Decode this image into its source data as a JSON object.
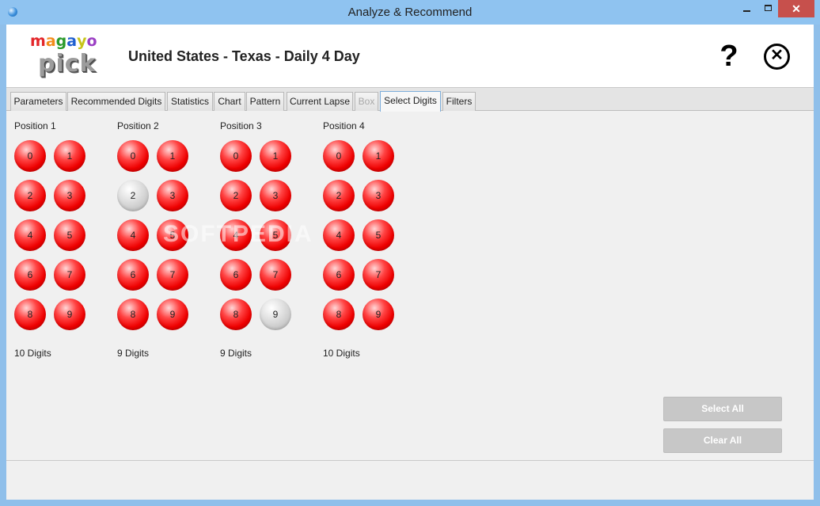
{
  "window": {
    "title": "Analyze & Recommend",
    "minimize_icon": "minimize-icon",
    "maximize_icon": "maximize-icon",
    "close_label": "✕"
  },
  "header": {
    "logo_top": [
      "m",
      "a",
      "g",
      "a",
      "y",
      "o"
    ],
    "logo_top_colors": [
      "#e3262a",
      "#f28c1a",
      "#2a9a2a",
      "#1f5fd0",
      "#c7c41a",
      "#9b3fc4"
    ],
    "logo_bottom": "pick",
    "lottery_title": "United States - Texas - Daily 4 Day",
    "help_label": "?",
    "close_label": "✕"
  },
  "tabs": [
    {
      "label": "Parameters",
      "state": "normal"
    },
    {
      "label": "Recommended Digits",
      "state": "normal"
    },
    {
      "label": "Statistics",
      "state": "normal"
    },
    {
      "label": "Chart",
      "state": "normal"
    },
    {
      "label": "Pattern",
      "state": "normal"
    },
    {
      "label": "Current Lapse",
      "state": "normal"
    },
    {
      "label": "Box",
      "state": "disabled"
    },
    {
      "label": "Select Digits",
      "state": "active"
    },
    {
      "label": "Filters",
      "state": "normal"
    }
  ],
  "positions": [
    {
      "label": "Position 1",
      "digits": [
        "0",
        "1",
        "2",
        "3",
        "4",
        "5",
        "6",
        "7",
        "8",
        "9"
      ],
      "unselected": [],
      "count_label": "10 Digits"
    },
    {
      "label": "Position 2",
      "digits": [
        "0",
        "1",
        "2",
        "3",
        "4",
        "5",
        "6",
        "7",
        "8",
        "9"
      ],
      "unselected": [
        "2"
      ],
      "count_label": "9 Digits"
    },
    {
      "label": "Position 3",
      "digits": [
        "0",
        "1",
        "2",
        "3",
        "4",
        "5",
        "6",
        "7",
        "8",
        "9"
      ],
      "unselected": [
        "9"
      ],
      "count_label": "9 Digits"
    },
    {
      "label": "Position 4",
      "digits": [
        "0",
        "1",
        "2",
        "3",
        "4",
        "5",
        "6",
        "7",
        "8",
        "9"
      ],
      "unselected": [],
      "count_label": "10 Digits"
    }
  ],
  "watermark": "SOFTPEDIA",
  "buttons": {
    "select_all": "Select All",
    "clear_all": "Clear All"
  },
  "colors": {
    "selected_ball": "#ee0000",
    "unselected_ball": "#c4c4c4",
    "active_tab_border": "#7eaedb"
  }
}
